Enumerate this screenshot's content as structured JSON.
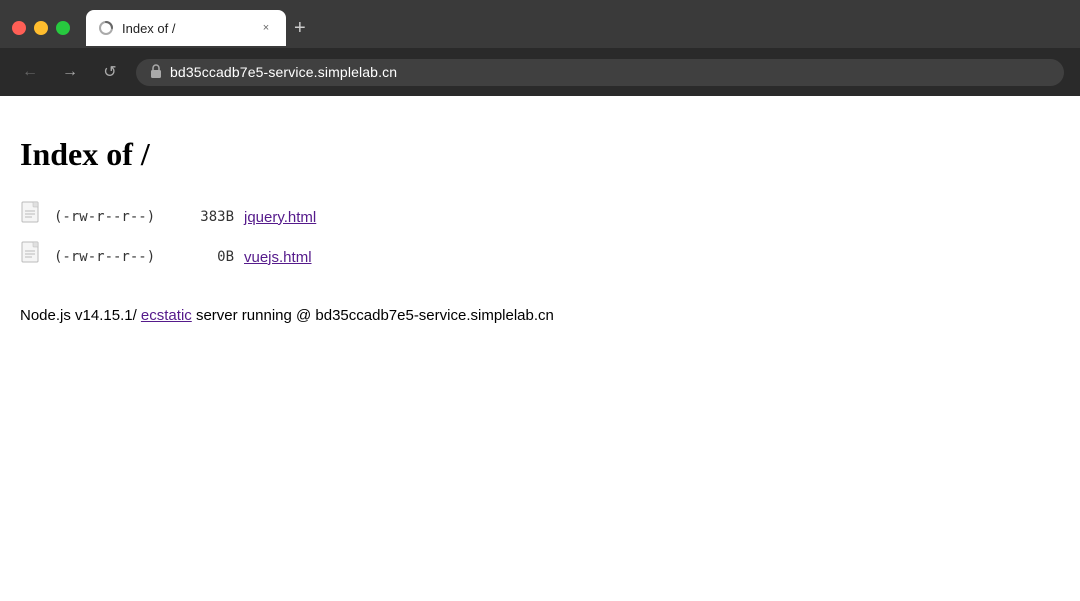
{
  "browser": {
    "tab": {
      "title": "Index of /",
      "close_label": "×",
      "new_tab_label": "+"
    },
    "nav": {
      "back": "←",
      "forward": "→",
      "reload": "↺"
    },
    "url": "bd35ccadb7e5-service.simplelab.cn"
  },
  "page": {
    "heading": "Index of /",
    "files": [
      {
        "permissions": "(-rw-r--r--)",
        "size": "383B",
        "name": "jquery.html",
        "href": "jquery.html"
      },
      {
        "permissions": "(-rw-r--r--)",
        "size": "0B",
        "name": "vuejs.html",
        "href": "vuejs.html"
      }
    ],
    "footer": {
      "prefix": "Node.js v14.15.1/ ",
      "link_text": "ecstatic",
      "suffix": " server running @ bd35ccadb7e5-service.simplelab.cn"
    }
  }
}
